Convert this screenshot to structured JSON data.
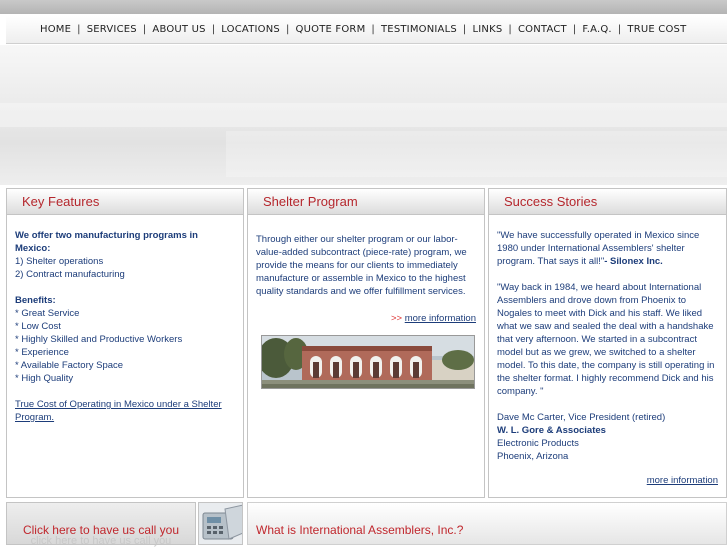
{
  "nav": {
    "items": [
      "HOME",
      "SERVICES",
      "ABOUT US",
      "LOCATIONS",
      "QUOTE FORM",
      "TESTIMONIALS",
      "LINKS",
      "CONTACT",
      "F.A.Q.",
      "TRUE COST"
    ],
    "separator": "|"
  },
  "key_features": {
    "title": "Key Features",
    "intro_heading": "We offer two manufacturing programs in Mexico:",
    "programs": [
      "1) Shelter operations",
      "2) Contract manufacturing"
    ],
    "benefits_heading": "Benefits:",
    "benefits": [
      "* Great Service",
      "* Low Cost",
      "* Highly Skilled and Productive Workers",
      "* Experience",
      "* Available Factory Space",
      "* High Quality"
    ],
    "true_cost_link": "True Cost of Operating in Mexico under a Shelter Program."
  },
  "shelter_program": {
    "title": "Shelter Program",
    "body": "Through either our shelter program or our labor-value-added subcontract (piece-rate) program, we provide the means for our clients to immediately manufacture or assemble in Mexico to the highest quality standards and we offer fulfillment services.",
    "more_arrow": ">>",
    "more_label": "more information"
  },
  "success_stories": {
    "title": "Success Stories",
    "quote1": "\"We have successfully operated in Mexico since 1980 under International Assemblers' shelter program. That says it all!\"",
    "quote1_author": "- Silonex Inc.",
    "quote2": "\"Way back in 1984, we heard about International Assemblers and drove down from Phoenix to Nogales to meet with Dick and his staff. We liked what we saw and sealed the deal with a handshake that very afternoon. We started in a subcontract model but as we grew, we switched to a shelter model. To this date, the company is still operating in the shelter format. I highly recommend Dick and his company. \"",
    "person": "Dave Mc Carter, Vice President (retired)",
    "company": "W. L. Gore & Associates",
    "division": "Electronic Products",
    "location": "Phoenix, Arizona",
    "more_label": "more information"
  },
  "call_us": {
    "label": "Click here to have us call you",
    "ghost": "click here to have us call you"
  },
  "what_is": {
    "title": "What is International Assemblers, Inc.?"
  },
  "colors": {
    "accent_red": "#c0272d",
    "text_blue": "#1d3d7a"
  }
}
